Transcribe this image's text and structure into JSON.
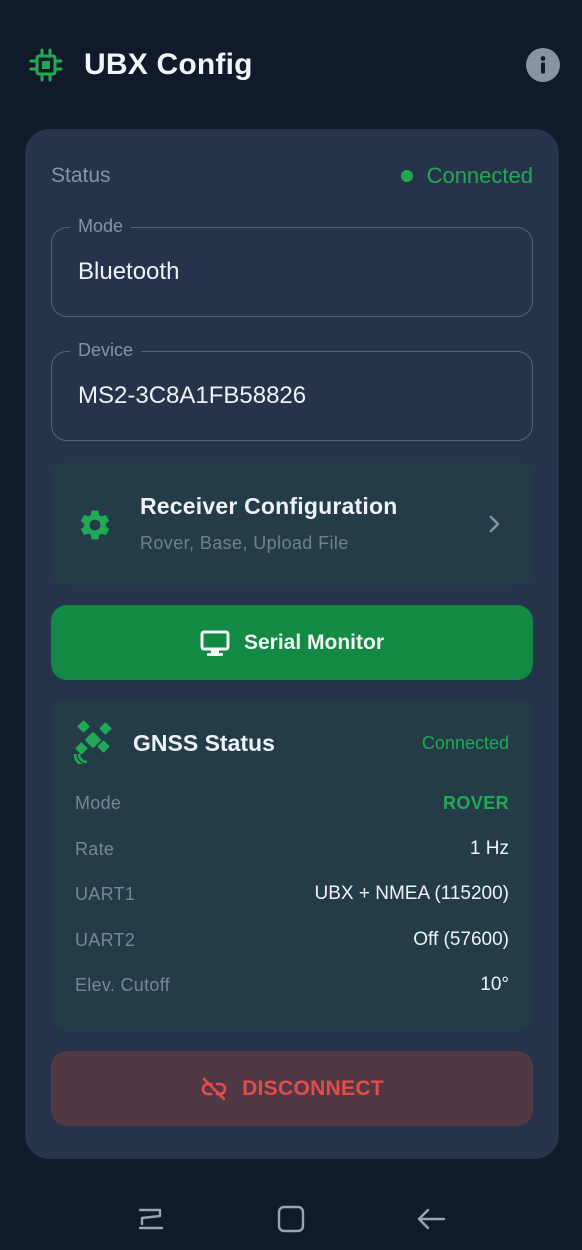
{
  "header": {
    "title": "UBX Config",
    "icons": {
      "app": "chip-icon",
      "info": "info-icon"
    }
  },
  "status": {
    "label": "Status",
    "value": "Connected"
  },
  "fields": {
    "mode": {
      "label": "Mode",
      "value": "Bluetooth"
    },
    "device": {
      "label": "Device",
      "value": "MS2-3C8A1FB58826"
    }
  },
  "receiver_config": {
    "title": "Receiver Configuration",
    "subtitle": "Rover, Base, Upload File",
    "icon": "gear-icon"
  },
  "serial_monitor": {
    "label": "Serial Monitor",
    "icon": "monitor-icon"
  },
  "gnss": {
    "title": "GNSS Status",
    "connection": "Connected",
    "icon": "satellite-icon",
    "rows": [
      {
        "key": "Mode",
        "value": "ROVER"
      },
      {
        "key": "Rate",
        "value": "1 Hz"
      },
      {
        "key": "UART1",
        "value": "UBX + NMEA (115200)"
      },
      {
        "key": "UART2",
        "value": "Off (57600)"
      },
      {
        "key": "Elev. Cutoff",
        "value": "10°"
      }
    ]
  },
  "disconnect": {
    "label": "DISCONNECT",
    "icon": "link-off-icon"
  },
  "navbar": {
    "icons": [
      "recent-apps-icon",
      "home-icon",
      "back-icon"
    ]
  },
  "colors": {
    "background": "#111a2b",
    "card": "#26334a",
    "accent_green": "#22a955",
    "button_green": "#138a43",
    "danger": "#e54b4b",
    "danger_bg": "#513845"
  }
}
